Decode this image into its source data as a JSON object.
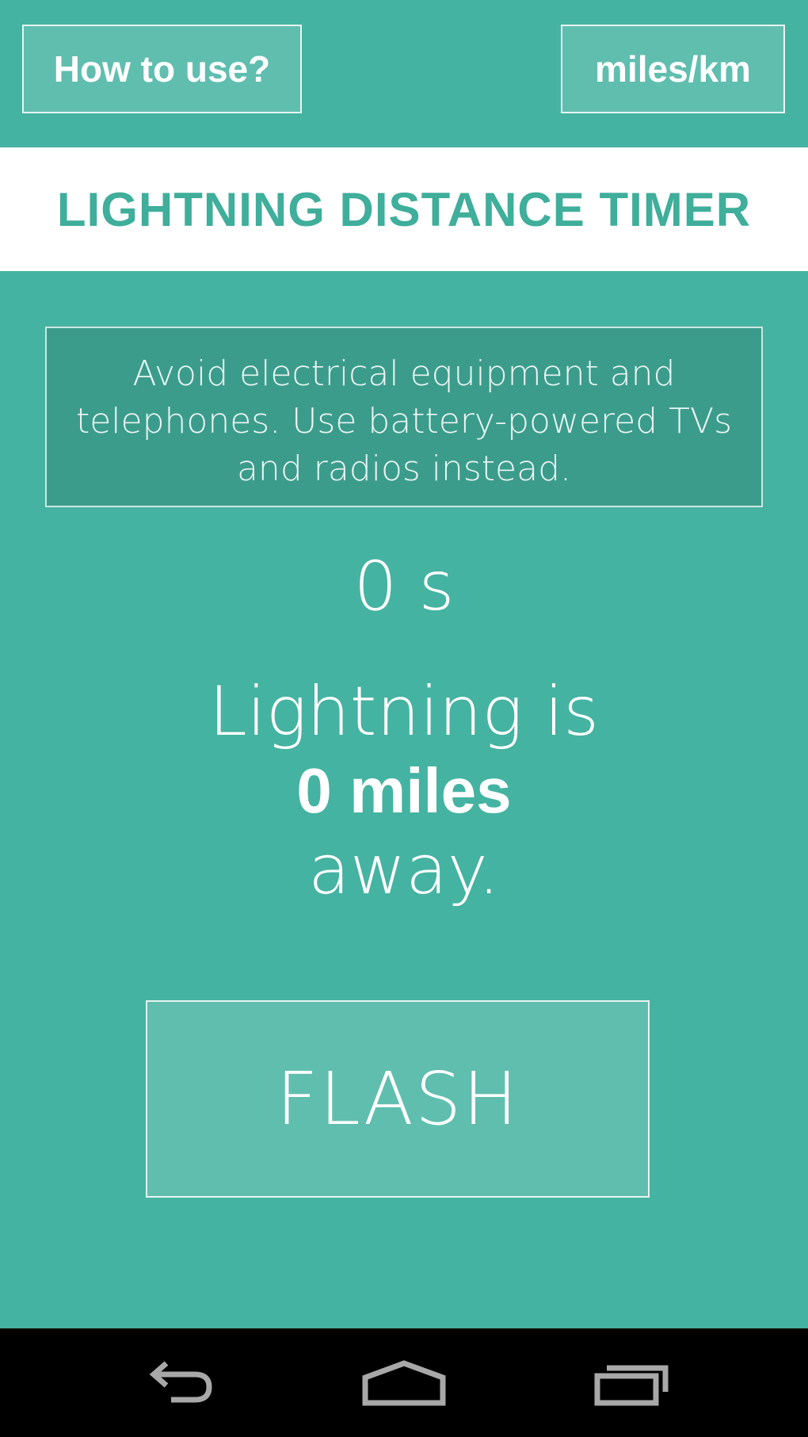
{
  "header": {
    "how_to_use_label": "How to use?",
    "units_label": "miles/km"
  },
  "title": "LIGHTNING DISTANCE TIMER",
  "tip": "Avoid electrical equipment and telephones. Use battery-powered TVs and radios instead.",
  "timer": {
    "seconds_text": "0 s"
  },
  "distance": {
    "prefix": "Lightning is",
    "value_text": "0 miles",
    "suffix": "away."
  },
  "flash_label": "FLASH",
  "navbar": {
    "icons": [
      "back-icon",
      "home-icon",
      "recents-icon"
    ]
  },
  "colors": {
    "background": "#45b3a1",
    "title_text": "#3fae9b",
    "tip_background": "#3c9c8c",
    "navbar": "#000000"
  }
}
